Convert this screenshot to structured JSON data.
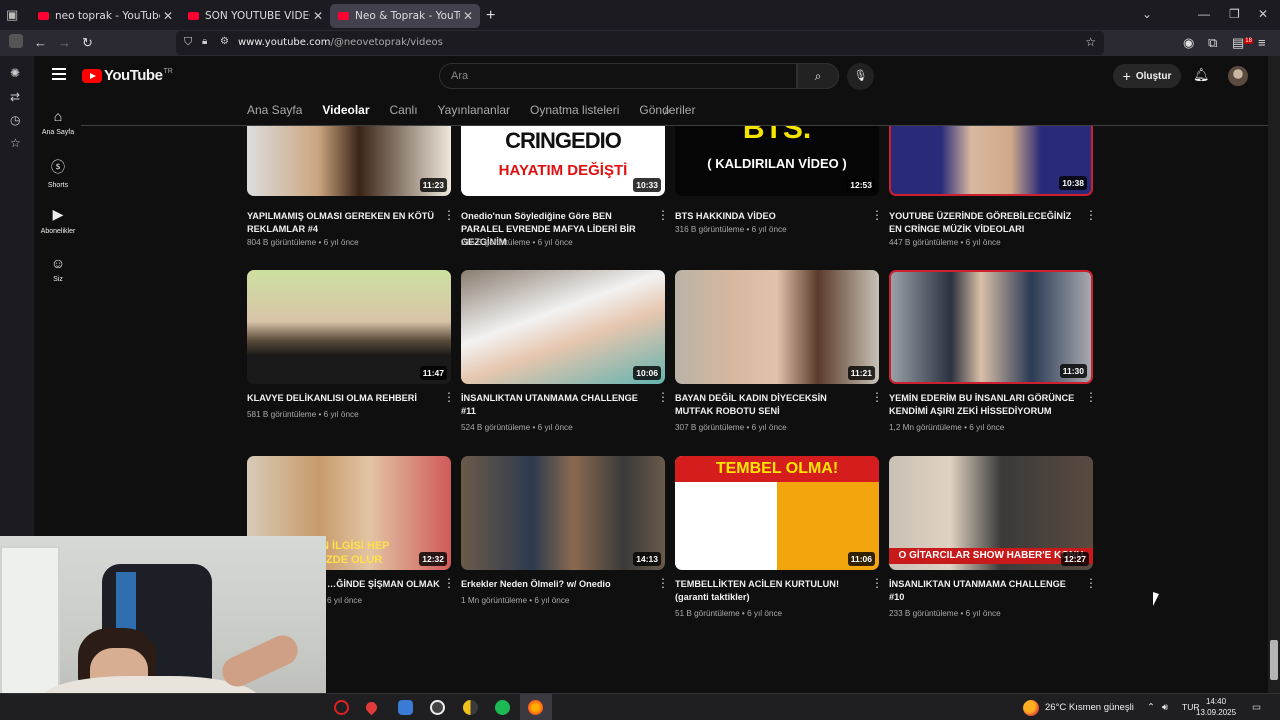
{
  "browser": {
    "tabs": [
      {
        "title": "neo toprak - YouTube",
        "active": false
      },
      {
        "title": "SON YOUTUBE VİDEOM - YouTu",
        "active": false
      },
      {
        "title": "Neo & Toprak - YouTube",
        "active": true
      }
    ],
    "url_host": "www.youtube.com",
    "url_path": "/@neovetoprak/videos",
    "badge_count": "18"
  },
  "youtube": {
    "logo_text": "YouTube",
    "country_code": "TR",
    "search_placeholder": "Ara",
    "create_label": "Oluştur",
    "guide": [
      {
        "label": "Ana Sayfa",
        "icon": "home-icon"
      },
      {
        "label": "Shorts",
        "icon": "shorts-icon"
      },
      {
        "label": "Abonelikler",
        "icon": "subscriptions-icon"
      },
      {
        "label": "Siz",
        "icon": "you-icon"
      }
    ],
    "channel_tabs": [
      "Ana Sayfa",
      "Videolar",
      "Canlı",
      "Yayınlananlar",
      "Oynatma listeleri",
      "Gönderiler"
    ],
    "selected_tab": "Videolar"
  },
  "videos": [
    {
      "title": "YAPILMAMIŞ OLMASI GEREKEN EN KÖTÜ REKLAMLAR #4",
      "duration": "11:23",
      "views": "804 B görüntüleme",
      "age": "6 yıl önce",
      "thumb_text": ""
    },
    {
      "title": "Onedio'nun Söylediğine Göre BEN PARALEL EVRENDE MAFYA LİDERİ BİR GEZGİNİM",
      "duration": "10:33",
      "views": "216 B görüntüleme",
      "age": "6 yıl önce",
      "thumb_text": "CRINGEDIO|HAYATIM DEĞİŞTİ"
    },
    {
      "title": "BTS HAKKINDA VİDEO",
      "duration": "12:53",
      "views": "316 B görüntüleme",
      "age": "6 yıl önce",
      "thumb_text": "BTS.|( KALDIRILAN VİDEO )"
    },
    {
      "title": "YOUTUBE ÜZERİNDE GÖREBİLECEĞİNİZ EN CRİNGE MÜZİK VİDEOLARI",
      "duration": "10:38",
      "views": "447 B görüntüleme",
      "age": "6 yıl önce",
      "thumb_text": ""
    },
    {
      "title": "KLAVYE DELİKANLISI OLMA REHBERİ",
      "duration": "11:47",
      "views": "581 B görüntüleme",
      "age": "6 yıl önce",
      "thumb_text": ""
    },
    {
      "title": "İNSANLIKTAN UTANMAMA CHALLENGE #11",
      "duration": "10:06",
      "views": "524 B görüntüleme",
      "age": "6 yıl önce",
      "thumb_text": ""
    },
    {
      "title": "BAYAN DEĞİL KADIN DİYECEKSİN MUTFAK ROBOTU SENİ",
      "duration": "11:21",
      "views": "307 B görüntüleme",
      "age": "6 yıl önce",
      "thumb_text": ""
    },
    {
      "title": "YEMİN EDERİM BU İNSANLARI GÖRÜNCE KENDİMİ AŞIRI ZEKİ HİSSEDİYORUM",
      "duration": "11:30",
      "views": "1,2 Mn görüntüleme",
      "age": "6 yıl önce",
      "thumb_text": ""
    },
    {
      "title": "…ĞİNDE ŞİŞMAN OLMAK",
      "duration": "12:32",
      "views": "",
      "age": "6 yıl önce",
      "thumb_text": "…IN İLGİSİ HEP|…ÜZDE OLUR"
    },
    {
      "title": "Erkekler Neden Ölmeli? w/ Onedio",
      "duration": "14:13",
      "views": "1 Mn görüntüleme",
      "age": "6 yıl önce",
      "thumb_text": ""
    },
    {
      "title": "TEMBELLİKTEN ACİLEN KURTULUN! (garanti taktikler)",
      "duration": "11:06",
      "views": "51 B görüntüleme",
      "age": "6 yıl önce",
      "thumb_text": "TEMBEL OLMA!"
    },
    {
      "title": "İNSANLIKTAN UTANMAMA CHALLENGE #10",
      "duration": "12:27",
      "views": "233 B görüntüleme",
      "age": "6 yıl önce",
      "thumb_text": "O GİTARCILAR SHOW HABER'E KONU"
    }
  ],
  "taskbar": {
    "weather": "26°C  Kısmen güneşli",
    "lang": "TUR",
    "time": "14:40",
    "date": "13.09.2025"
  },
  "colors": {
    "brand_red": "#ff0000",
    "bg": "#0f0f0f",
    "accent_red_border": "#cc1f2f"
  }
}
